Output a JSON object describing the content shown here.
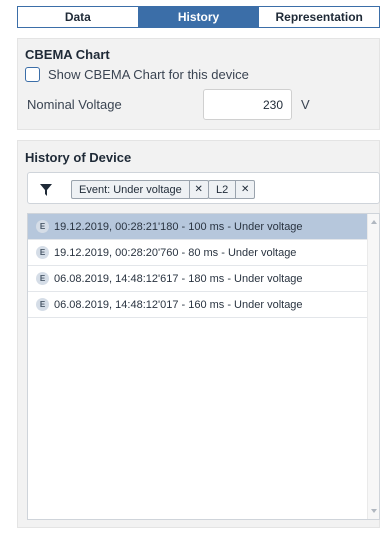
{
  "tabs": [
    {
      "label": "Data",
      "active": false
    },
    {
      "label": "History",
      "active": true
    },
    {
      "label": "Representation",
      "active": false
    }
  ],
  "cbema": {
    "title": "CBEMA Chart",
    "checkbox_label": "Show CBEMA Chart for this device",
    "checked": false,
    "voltage_label": "Nominal Voltage",
    "voltage_value": "230",
    "voltage_unit": "V"
  },
  "history": {
    "title": "History of Device",
    "filter_icon": "filter-funnel-icon",
    "filters": [
      {
        "label": "Event: Under voltage",
        "close": "✕"
      },
      {
        "label": "L2",
        "close": "✕"
      }
    ],
    "badge": "E",
    "entries": [
      {
        "text": "19.12.2019, 00:28:21'180 - 100 ms - Under voltage",
        "selected": true
      },
      {
        "text": "19.12.2019, 00:28:20'760 - 80 ms - Under voltage",
        "selected": false
      },
      {
        "text": "06.08.2019, 14:48:12'617 - 180 ms - Under voltage",
        "selected": false
      },
      {
        "text": "06.08.2019, 14:48:12'017 - 160 ms - Under voltage",
        "selected": false
      }
    ]
  },
  "colors": {
    "accent": "#3b6ea8",
    "selected_row": "#b6c7dc",
    "panel_bg": "#f2f2f2"
  }
}
